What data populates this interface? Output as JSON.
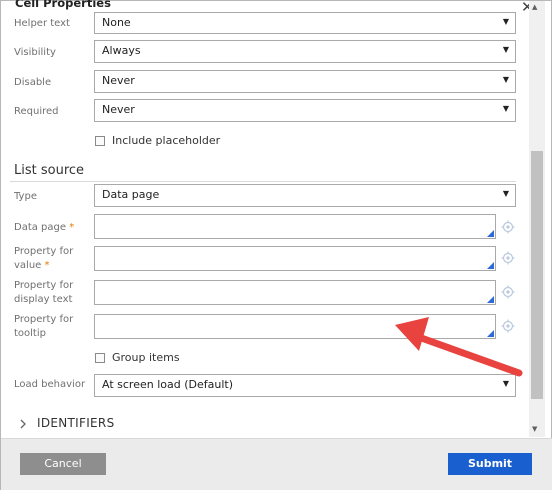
{
  "dialog": {
    "title": "Cell Properties",
    "close_glyph": "✕"
  },
  "fields": {
    "helper_text": {
      "label": "Helper text",
      "value": "None"
    },
    "visibility": {
      "label": "Visibility",
      "value": "Always"
    },
    "disable": {
      "label": "Disable",
      "value": "Never"
    },
    "required": {
      "label": "Required",
      "value": "Never"
    },
    "include_placeholder": {
      "label": "Include placeholder",
      "checked": false
    }
  },
  "list_source": {
    "heading": "List source",
    "type": {
      "label": "Type",
      "value": "Data page"
    },
    "data_page": {
      "label": "Data page",
      "value": ""
    },
    "property_value": {
      "label_line1": "Property for",
      "label_line2": "value",
      "value": ""
    },
    "property_display": {
      "label_line1": "Property for",
      "label_line2": "display text",
      "value": ""
    },
    "property_tooltip": {
      "label_line1": "Property for",
      "label_line2": "tooltip",
      "value": ""
    },
    "group_items": {
      "label": "Group items",
      "checked": false
    },
    "load_behavior": {
      "label": "Load behavior",
      "value": "At screen load (Default)"
    }
  },
  "identifiers": {
    "label": "IDENTIFIERS"
  },
  "footer": {
    "cancel_label": "Cancel",
    "submit_label": "Submit"
  },
  "glyphs": {
    "required_star": "*",
    "dropdown_arrow": "▼",
    "scroll_up": "▲",
    "scroll_down": "▼"
  },
  "colors": {
    "submit": "#1a5fd0",
    "cancel": "#8e8e8e",
    "annotation_arrow": "#e8433e",
    "required_star": "#e07b00"
  }
}
